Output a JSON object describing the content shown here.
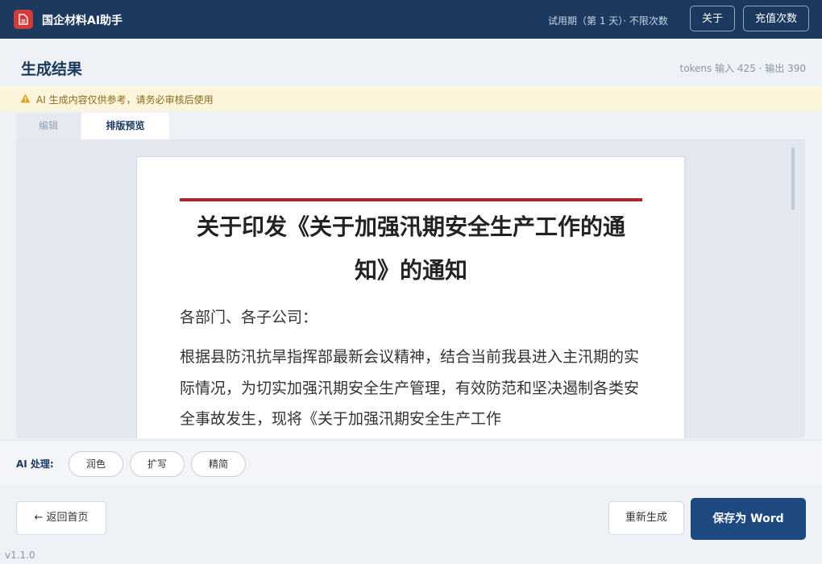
{
  "header": {
    "app_title": "国企材料AI助手",
    "trial_status": "试用期（第 1 天）· 不限次数",
    "about_label": "关于",
    "recharge_label": "充值次数"
  },
  "result": {
    "title": "生成结果",
    "tokens": "tokens 输入 425 · 输出 390"
  },
  "warning": {
    "text": "AI 生成内容仅供参考，请务必审核后使用"
  },
  "tabs": [
    {
      "label": "编辑",
      "active": false
    },
    {
      "label": "排版预览",
      "active": true
    }
  ],
  "document": {
    "title": "关于印发《关于加强汛期安全生产工作的通知》的通知",
    "salutation": "各部门、各子公司：",
    "paragraph": "根据县防汛抗旱指挥部最新会议精神，结合当前我县进入主汛期的实际情况，为切实加强汛期安全生产管理，有效防范和坚决遏制各类安全事故发生，现将《关于加强汛期安全生产工作"
  },
  "ai_tools": {
    "label": "AI 处理:",
    "buttons": [
      "润色",
      "扩写",
      "精简"
    ]
  },
  "footer": {
    "back_label": "← 返回首页",
    "regenerate_label": "重新生成",
    "save_label": "保存为 Word",
    "version": "v1.1.0"
  },
  "colors": {
    "header_bg": "#1c3a60",
    "brand_red": "#d33a3a",
    "warning_bg": "#fcf5dc",
    "doc_rule": "#a7272b",
    "primary_button": "#1e4880"
  }
}
